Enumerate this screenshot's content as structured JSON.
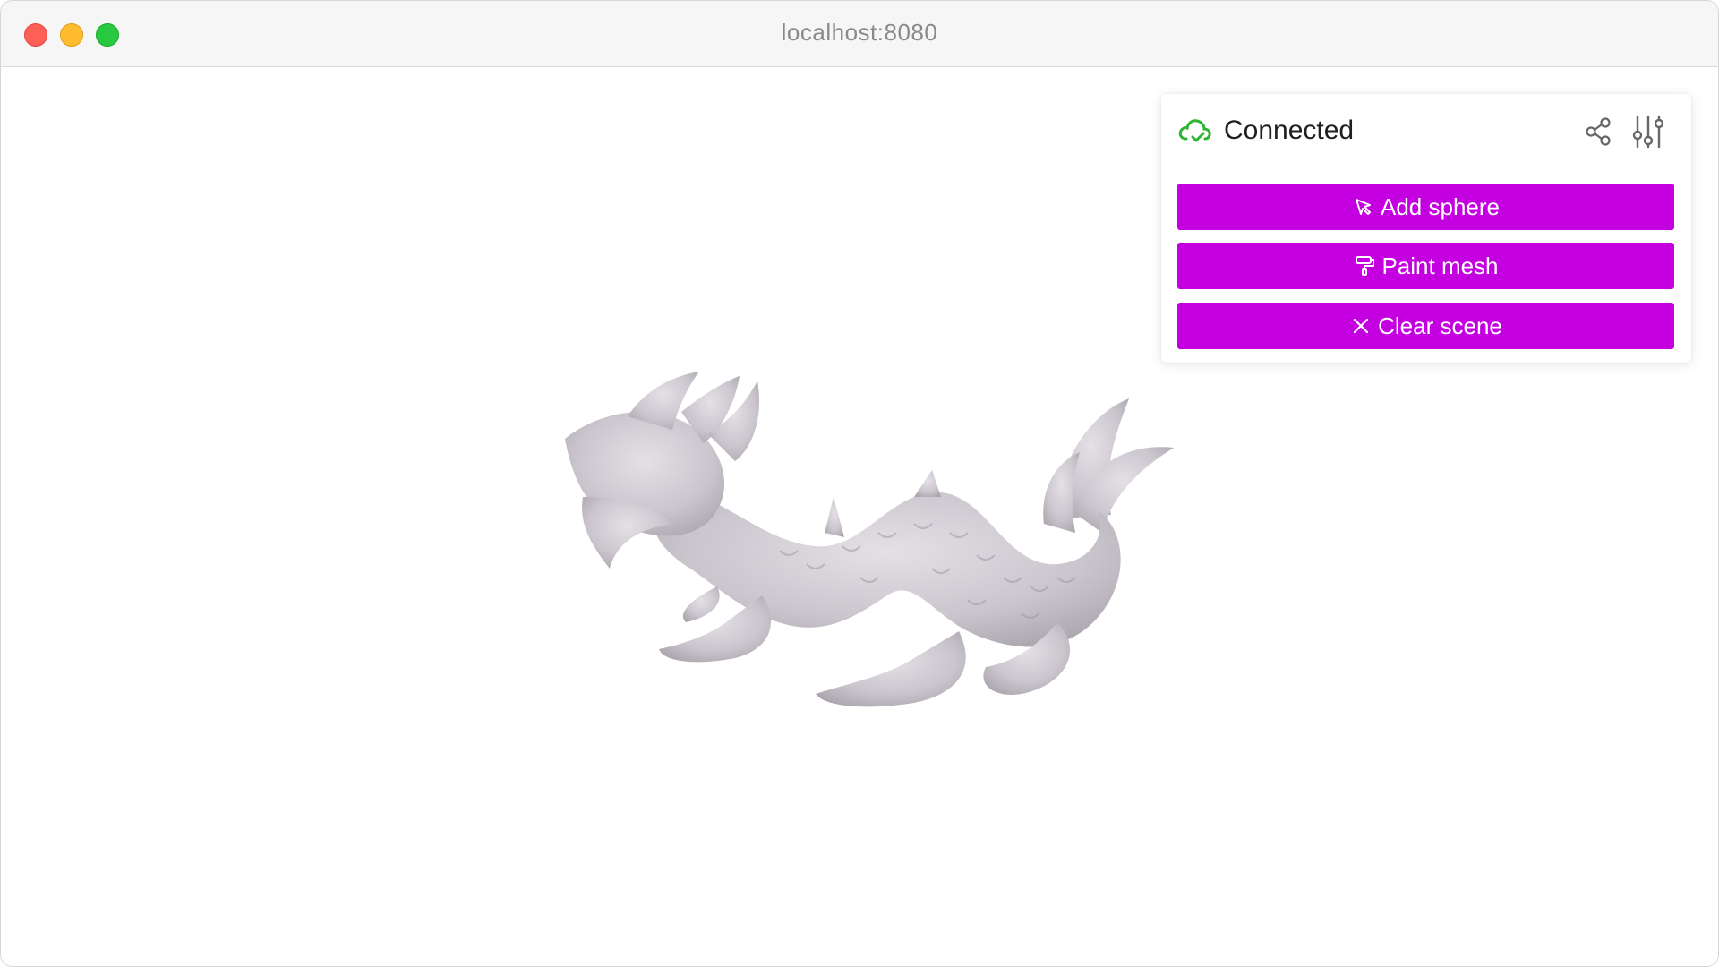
{
  "window": {
    "url": "localhost:8080"
  },
  "panel": {
    "status": {
      "label": "Connected",
      "icon": "cloud-check-icon",
      "color": "#2bb530"
    },
    "header_actions": [
      {
        "icon": "share-icon"
      },
      {
        "icon": "sliders-icon"
      }
    ],
    "buttons": [
      {
        "label": "Add sphere",
        "icon": "cursor-click-icon"
      },
      {
        "label": "Paint mesh",
        "icon": "paint-roller-icon"
      },
      {
        "label": "Clear scene",
        "icon": "close-icon"
      }
    ],
    "accent_color": "#c400e0"
  },
  "scene": {
    "object": "dragon-mesh"
  }
}
